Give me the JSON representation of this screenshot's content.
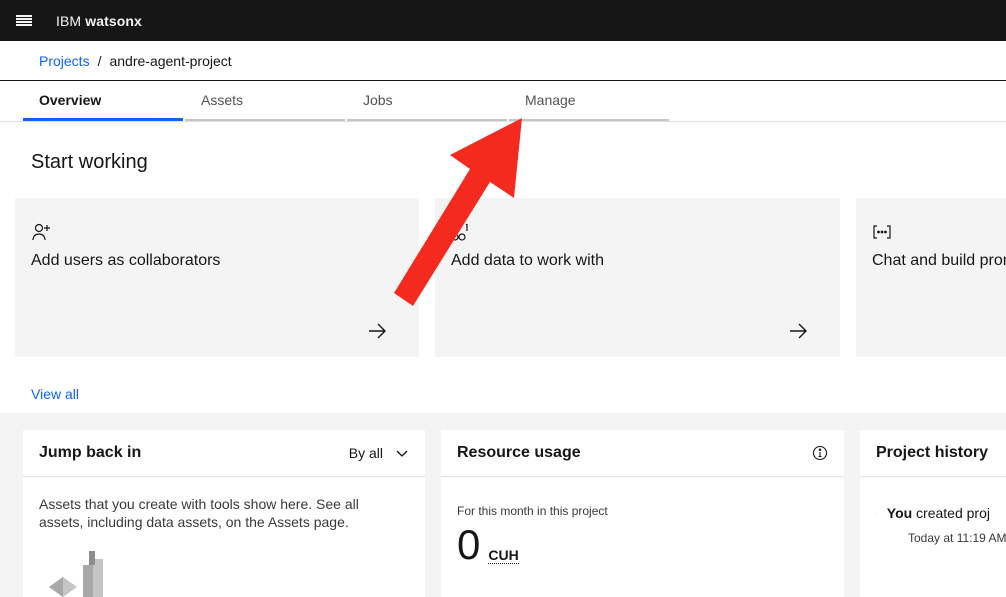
{
  "topbar": {
    "brand_prefix": "IBM",
    "brand_name": "watsonx"
  },
  "breadcrumb": {
    "parent": "Projects",
    "separator": "/",
    "current": "andre-agent-project"
  },
  "tabs": [
    {
      "label": "Overview",
      "active": true
    },
    {
      "label": "Assets",
      "active": false
    },
    {
      "label": "Jobs",
      "active": false
    },
    {
      "label": "Manage",
      "active": false
    }
  ],
  "start_working": {
    "title": "Start working",
    "tiles": [
      {
        "label": "Add users as collaborators",
        "icon": "add-user-icon"
      },
      {
        "label": "Add data to work with",
        "icon": "data-icon"
      },
      {
        "label": "Chat and build prom",
        "icon": "code-brackets-icon"
      }
    ],
    "view_all": "View all"
  },
  "jump_back_in": {
    "title": "Jump back in",
    "filter": "By all",
    "text": "Assets that you create with tools show here. See all assets, including data assets, on the Assets page."
  },
  "resource_usage": {
    "title": "Resource usage",
    "caption": "For this month in this project",
    "value": "0",
    "unit": "CUH"
  },
  "project_history": {
    "title": "Project history",
    "actor": "You",
    "action": " created proj",
    "time": "Today at 11:19 AM"
  },
  "colors": {
    "accent": "#0f62fe",
    "topbar": "#161616",
    "annotation": "#f42a1f"
  }
}
